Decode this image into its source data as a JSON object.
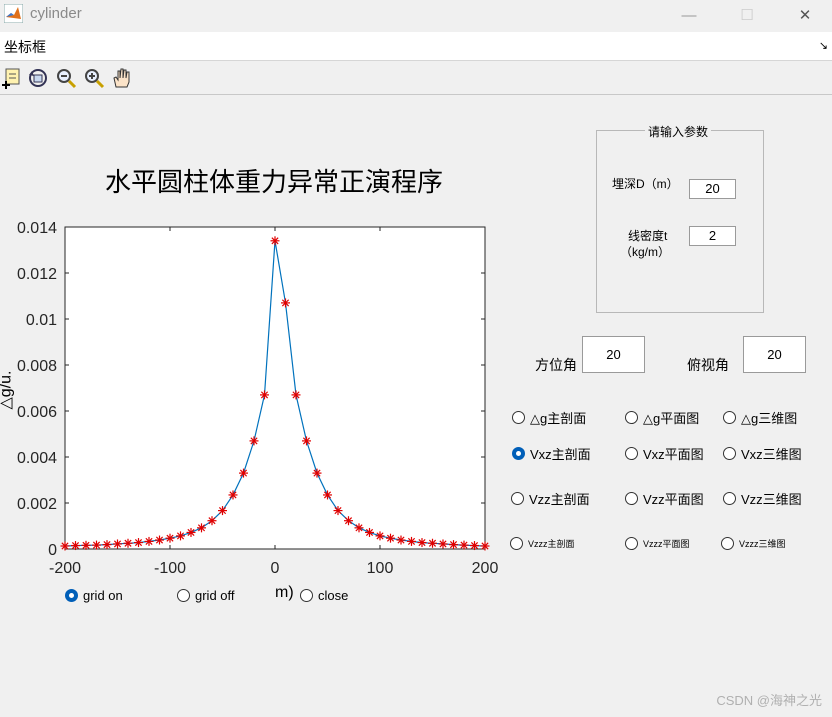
{
  "window": {
    "title": "cylinder",
    "minimize": "—",
    "maximize": "☐",
    "close": "✕"
  },
  "menubar": {
    "label": "坐标框",
    "arrow": "↘"
  },
  "toolbar": {
    "icons": [
      "data-cursor-icon",
      "rotate-3d-icon",
      "zoom-out-icon",
      "zoom-in-icon",
      "pan-hand-icon"
    ]
  },
  "plot": {
    "title": "水平圆柱体重力异常正演程序",
    "ylabel": "△g/u.",
    "xlabel_fragment": "m)"
  },
  "chart_data": {
    "type": "line",
    "title": "水平圆柱体重力异常正演程序",
    "xlabel": "m)",
    "ylabel": "△g/u.",
    "xlim": [
      -200,
      200
    ],
    "ylim": [
      0,
      0.014
    ],
    "x_ticks": [
      "-200",
      "-100",
      "0",
      "100",
      "200"
    ],
    "y_ticks": [
      "0",
      "0.002",
      "0.004",
      "0.006",
      "0.008",
      "0.01",
      "0.012",
      "0.014"
    ],
    "line_color": "#0072bd",
    "marker_color": "#e00000",
    "marker": "*",
    "grid": false,
    "x": [
      -200,
      -190,
      -180,
      -170,
      -160,
      -150,
      -140,
      -130,
      -120,
      -110,
      -100,
      -90,
      -80,
      -70,
      -60,
      -50,
      -40,
      -30,
      -20,
      -10,
      0,
      10,
      20,
      30,
      40,
      50,
      60,
      70,
      80,
      90,
      100,
      110,
      120,
      130,
      140,
      150,
      160,
      170,
      180,
      190,
      200
    ],
    "values": [
      0.00013,
      0.00015,
      0.00016,
      0.00017,
      0.00019,
      0.00022,
      0.00025,
      0.00028,
      0.00033,
      0.00039,
      0.00047,
      0.00057,
      0.00072,
      0.00092,
      0.00123,
      0.00167,
      0.00235,
      0.0033,
      0.0047,
      0.0067,
      0.0134,
      0.0107,
      0.0067,
      0.0047,
      0.0033,
      0.00235,
      0.00167,
      0.00123,
      0.00092,
      0.00072,
      0.00057,
      0.00047,
      0.00039,
      0.00033,
      0.00028,
      0.00025,
      0.00022,
      0.00019,
      0.00017,
      0.00015,
      0.00013
    ]
  },
  "grid_controls": [
    {
      "label": "grid on",
      "selected": true
    },
    {
      "label": "grid off",
      "selected": false
    },
    {
      "label": "close",
      "selected": false
    }
  ],
  "params": {
    "panel_title": "请输入参数",
    "depth_label": "埋深D（m）",
    "depth_value": "20",
    "density_label_1": "线密度t",
    "density_label_2": "（kg/m）",
    "density_value": "2"
  },
  "view": {
    "azimuth_label": "方位角",
    "azimuth_value": "20",
    "elevation_label": "俯视角",
    "elevation_value": "20"
  },
  "plot_options": [
    {
      "label": "△g主剖面",
      "selected": false
    },
    {
      "label": "△g平面图",
      "selected": false
    },
    {
      "label": "△g三维图",
      "selected": false
    },
    {
      "label": "Vxz主剖面",
      "selected": true
    },
    {
      "label": "Vxz平面图",
      "selected": false
    },
    {
      "label": "Vxz三维图",
      "selected": false
    },
    {
      "label": "Vzz主剖面",
      "selected": false
    },
    {
      "label": "Vzz平面图",
      "selected": false
    },
    {
      "label": "Vzz三维图",
      "selected": false
    },
    {
      "label": "Vzzz主剖面",
      "selected": false
    },
    {
      "label": "Vzzz平面图",
      "selected": false
    },
    {
      "label": "Vzzz三维图",
      "selected": false
    }
  ],
  "watermark": "CSDN @海神之光"
}
